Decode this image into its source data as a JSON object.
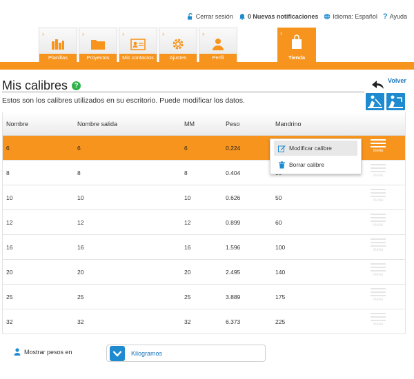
{
  "topbar": {
    "logout": "Cerrar sesión",
    "notifications": "0 Nuevas notificaciones",
    "language": "Idioma: Español",
    "help": "Ayuda"
  },
  "nav": {
    "tiles": [
      {
        "label": "Planillas",
        "icon": "spreadsheet-icon"
      },
      {
        "label": "Proyectos",
        "icon": "folder-icon"
      },
      {
        "label": "Mis contactos",
        "icon": "contact-card-icon"
      },
      {
        "label": "Ajustes",
        "icon": "gear-icon"
      },
      {
        "label": "Perfil",
        "icon": "user-icon"
      }
    ],
    "store": {
      "label": "Tienda",
      "icon": "shopping-bag-icon"
    }
  },
  "page": {
    "title": "Mis calibres",
    "help_icon": "?",
    "back": "Volver",
    "subtitle": "Estos son los calibres utilizados en su escritorio. Puede modificar los datos."
  },
  "table": {
    "headers": [
      "Nombre",
      "Nombre salida",
      "MM",
      "Peso",
      "Mandrino"
    ],
    "menu_label": "menu",
    "rows": [
      [
        "6",
        "6",
        "6",
        "0.224",
        ""
      ],
      [
        "8",
        "8",
        "8",
        "0.404",
        "30"
      ],
      [
        "10",
        "10",
        "10",
        "0.626",
        "50"
      ],
      [
        "12",
        "12",
        "12",
        "0.899",
        "60"
      ],
      [
        "16",
        "16",
        "16",
        "1.596",
        "100"
      ],
      [
        "20",
        "20",
        "20",
        "2.495",
        "140"
      ],
      [
        "25",
        "25",
        "25",
        "3.889",
        "175"
      ],
      [
        "32",
        "32",
        "32",
        "6.373",
        "225"
      ]
    ]
  },
  "context_menu": {
    "edit": "Modificar calibre",
    "delete": "Borrar calibre"
  },
  "footer": {
    "show_weights": "Mostrar pesos en",
    "units_value": "Kilogramos"
  },
  "colors": {
    "accent": "#f7941d",
    "blue": "#1e8bd0",
    "link": "#1b75bb",
    "help_green": "#2db34a"
  }
}
